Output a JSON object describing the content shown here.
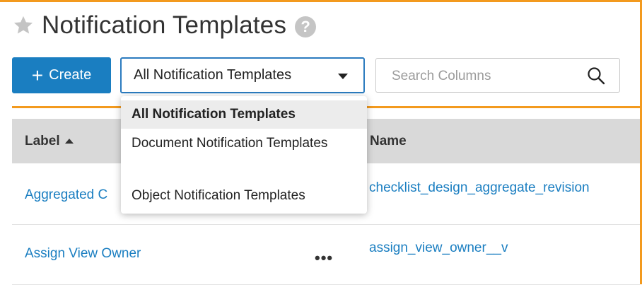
{
  "page": {
    "title": "Notification Templates",
    "help_glyph": "?",
    "accent_color": "#f39a1e",
    "primary_color": "#1a7ec1",
    "icons": [
      "star-icon",
      "help-icon",
      "plus-icon",
      "caret-down-icon",
      "search-icon",
      "sort-up-icon",
      "more-actions-icon"
    ]
  },
  "toolbar": {
    "create_label": "Create",
    "create_icon": "+",
    "filter_value": "All Notification Templates",
    "search_placeholder": "Search Columns"
  },
  "filter_menu": {
    "options": [
      {
        "label": "All Notification Templates",
        "selected": true
      },
      {
        "label": "Document Notification Templates",
        "selected": false
      },
      {
        "label": "Object Notification Templates",
        "selected": false
      }
    ]
  },
  "table": {
    "columns": [
      {
        "label": "Label",
        "sort": "ascending"
      },
      {
        "label": "Name"
      }
    ],
    "rows": [
      {
        "label": "Aggregated C",
        "name": "checklist_design_aggregate_revision"
      },
      {
        "label": "Assign View Owner",
        "actions": "•••",
        "name": "assign_view_owner__v"
      }
    ]
  }
}
